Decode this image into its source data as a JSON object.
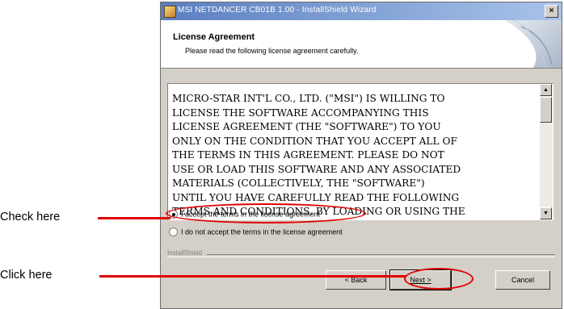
{
  "window": {
    "title": "MSI NETDANCER CB01B 1.00 - InstallShield Wizard",
    "close_glyph": "×"
  },
  "header": {
    "title": "License Agreement",
    "subtitle": "Please read the following license agreement carefully."
  },
  "license": {
    "text": "MICRO-STAR INT'L CO., LTD. (\"MSI\") IS WILLING TO\nLICENSE THE SOFTWARE ACCOMPANYING THIS\nLICENSE AGREEMENT (THE \"SOFTWARE\") TO YOU\nONLY ON THE CONDITION THAT YOU ACCEPT ALL OF\nTHE TERMS IN THIS AGREEMENT. PLEASE DO NOT\nUSE OR LOAD THIS SOFTWARE AND ANY ASSOCIATED\nMATERIALS (COLLECTIVELY, THE \"SOFTWARE\")\nUNTIL YOU HAVE CAREFULLY READ THE FOLLOWING\nTERMS AND CONDITIONS. BY LOADING OR USING THE",
    "scroll_up_glyph": "▲",
    "scroll_down_glyph": "▼"
  },
  "options": {
    "accept_label": "I accept the terms in the license agreement",
    "decline_label": "I do not accept the terms in the license agreement",
    "selected": "accept"
  },
  "footer": {
    "installshield_label": "InstallShield"
  },
  "buttons": {
    "back_label": "< Back",
    "next_label": "Next >",
    "cancel_label": "Cancel"
  },
  "annotations": {
    "check_label": "Check here",
    "click_label": "Click  here",
    "color": "#e10000"
  }
}
